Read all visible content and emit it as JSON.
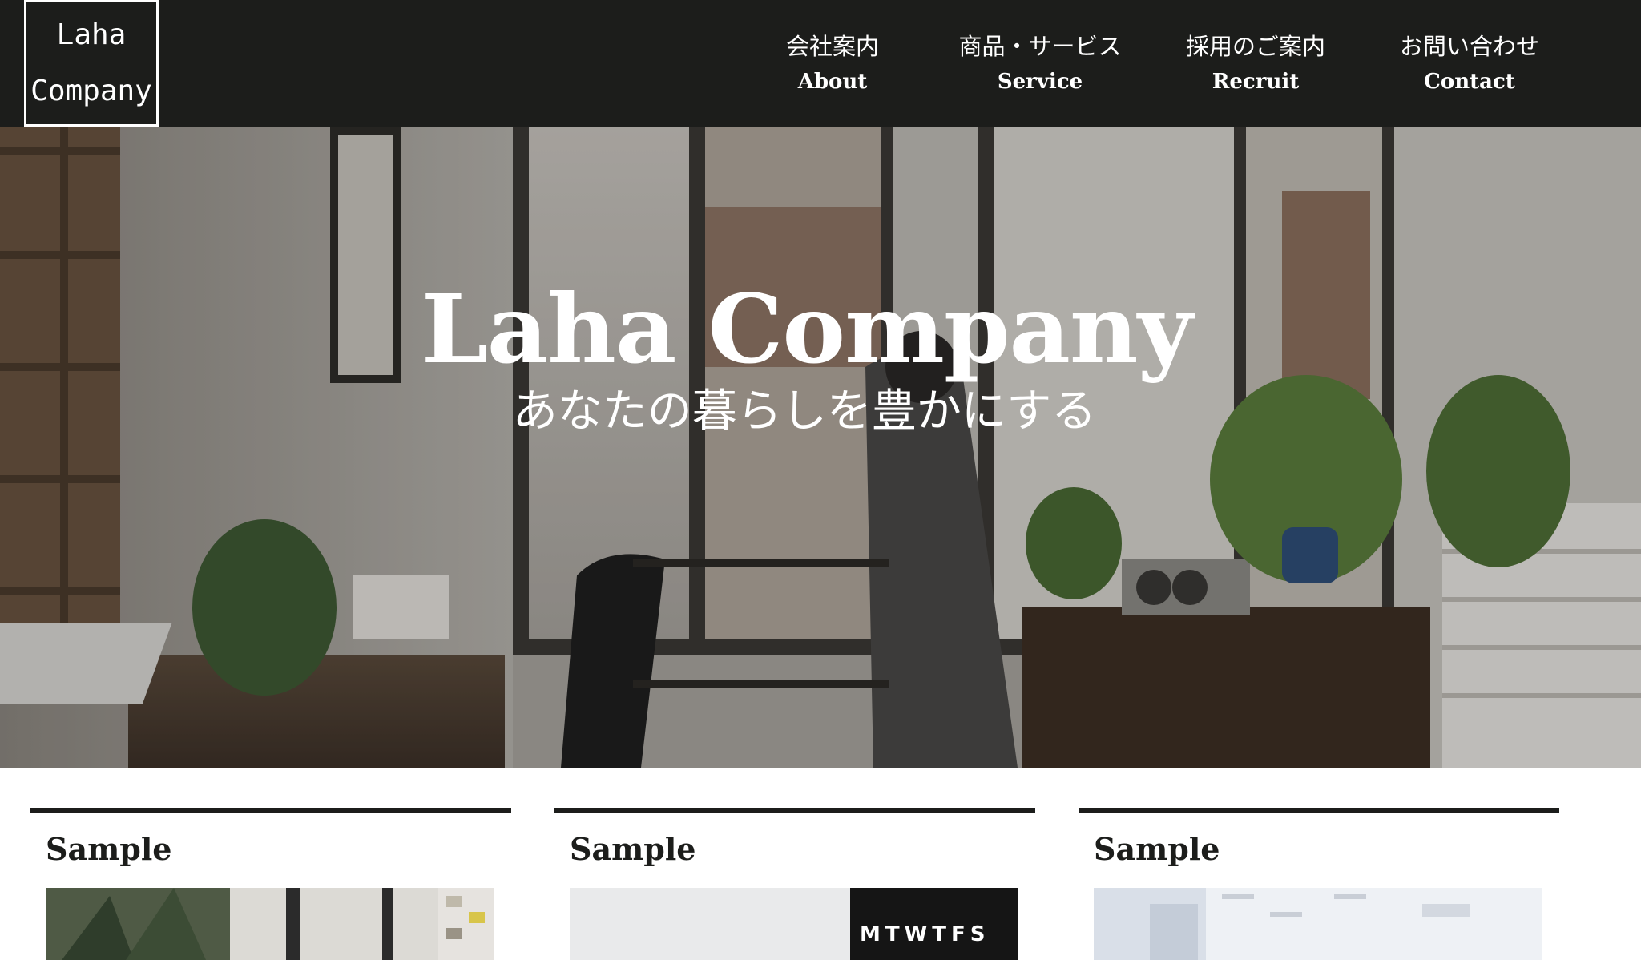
{
  "header": {
    "logo_line1": "Laha",
    "logo_line2": "Company",
    "nav": [
      {
        "jp": "会社案内",
        "en": "About"
      },
      {
        "jp": "商品・サービス",
        "en": "Service"
      },
      {
        "jp": "採用のご案内",
        "en": "Recruit"
      },
      {
        "jp": "お問い合わせ",
        "en": "Contact"
      }
    ]
  },
  "hero": {
    "title": "Laha Company",
    "subtitle": "あなたの暮らしを豊かにする",
    "image": "office-interior-photo"
  },
  "cards": [
    {
      "title": "Sample",
      "image": "plant-office-photo"
    },
    {
      "title": "Sample",
      "image": "calendar-photo"
    },
    {
      "title": "Sample",
      "image": "white-room-photo"
    }
  ],
  "colors": {
    "header_bg": "#1c1d1b",
    "text_light": "#ffffff",
    "text_dark": "#1c1d1b"
  }
}
